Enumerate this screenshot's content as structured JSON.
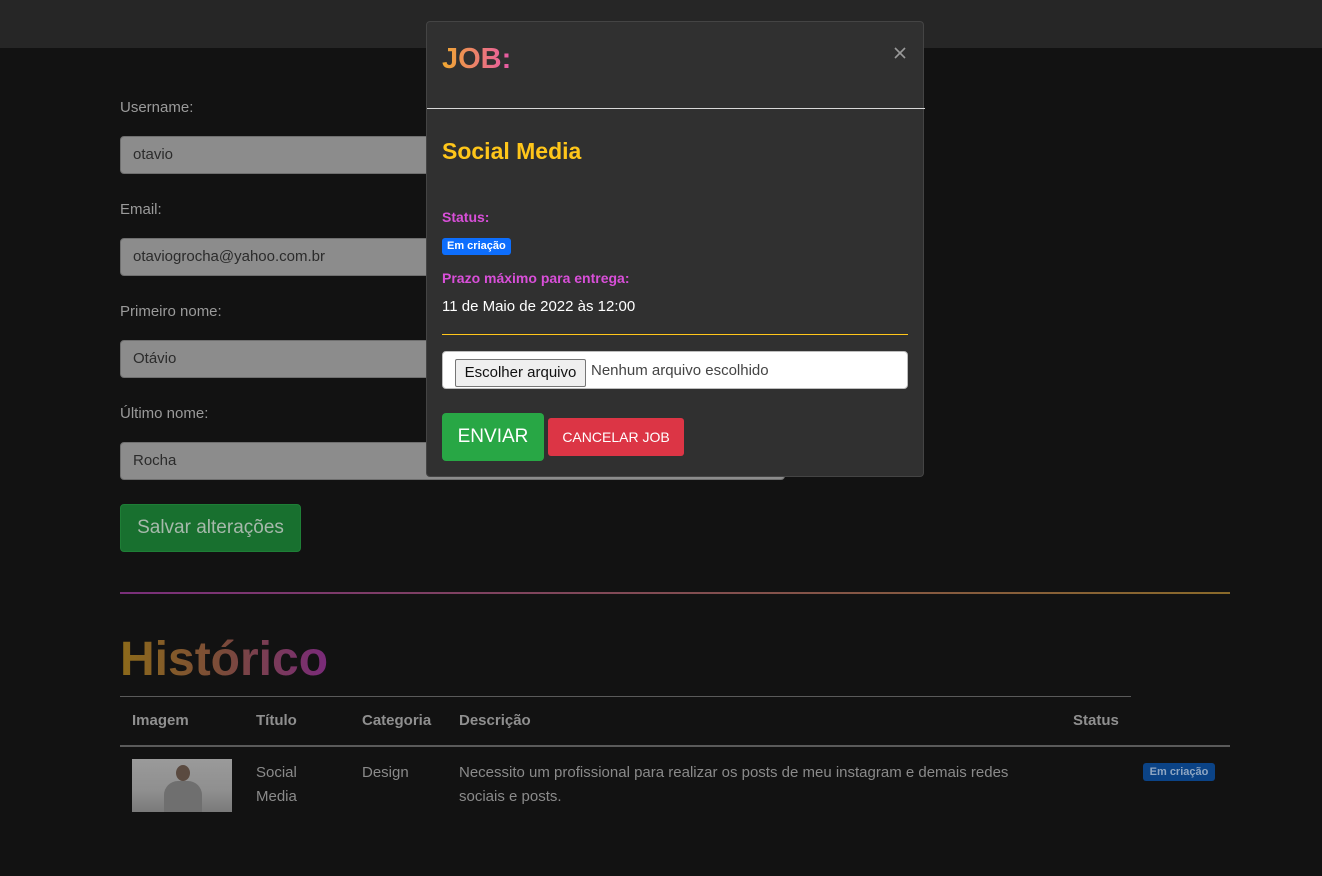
{
  "profile_form": {
    "username_label": "Username:",
    "username_value": "otavio",
    "email_label": "Email:",
    "email_value": "otaviogrocha@yahoo.com.br",
    "first_name_label": "Primeiro nome:",
    "first_name_value": "Otávio",
    "last_name_label": "Último nome:",
    "last_name_value": "Rocha",
    "save_label": "Salvar alterações"
  },
  "history": {
    "title": "Histórico",
    "columns": [
      "Imagem",
      "Título",
      "Categoria",
      "Descrição",
      "Status"
    ],
    "rows": [
      {
        "title_line1": "Social",
        "title_line2": "Media",
        "category": "Design",
        "description_line1": "Necessito um profissional para realizar os posts de meu instagram e demais redes",
        "description_line2": "sociais e posts.",
        "status": "Em criação"
      }
    ]
  },
  "modal": {
    "title": "JOB:",
    "close_icon": "close-icon",
    "job_title": "Social Media",
    "status_label": "Status:",
    "status_badge": "Em criação",
    "deadline_label": "Prazo máximo para entrega:",
    "deadline_value": "11 de Maio de 2022 às 12:00",
    "file_button": "Escolher arquivo",
    "file_status": "Nenhum arquivo escolhido",
    "submit_label": "ENVIAR",
    "cancel_label": "CANCELAR JOB"
  },
  "colors": {
    "accent_yellow": "#ffc61a",
    "accent_pink": "#d94fd9",
    "success": "#28a745",
    "danger": "#dc3545",
    "badge_blue": "#0d6efd"
  }
}
